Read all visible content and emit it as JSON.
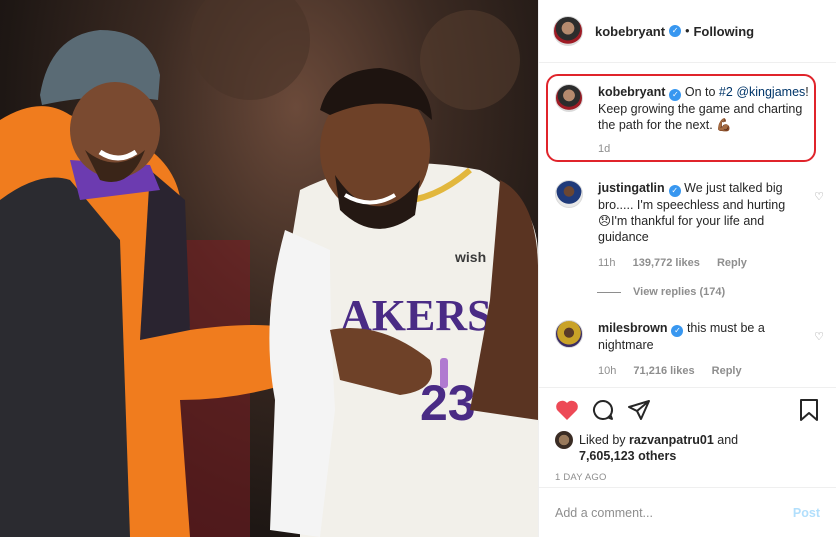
{
  "header": {
    "username": "kobebryant",
    "verified_icon": "verified-badge-icon",
    "separator": "•",
    "follow_status": "Following"
  },
  "caption": {
    "username": "kobebryant",
    "text_before": "On to ",
    "hashtag": "#2",
    "mention": "@kingjames",
    "text_after": "! Keep growing the game and charting the path for the next.",
    "emoji": "💪🏾",
    "time": "1d"
  },
  "comments": [
    {
      "username": "justingatlin",
      "text": "We just talked big bro..... I'm speechless and hurting",
      "emoji": "😞",
      "text2": "I'm thankful for your life and guidance",
      "time": "11h",
      "likes": "139,772 likes",
      "reply": "Reply",
      "view_replies": "View replies (174)"
    },
    {
      "username": "milesbrown",
      "text": "this must be a nightmare",
      "time": "10h",
      "likes": "71,216 likes",
      "reply": "Reply"
    }
  ],
  "likes": {
    "prefix": "Liked by ",
    "user": "razvanpatru01",
    "mid": " and",
    "count": "7,605,123 others"
  },
  "timestamp": "1 DAY AGO",
  "add_comment": {
    "placeholder": "Add a comment...",
    "post_label": "Post"
  },
  "colors": {
    "accent": "#3897f0",
    "like_red": "#ed4956",
    "highlight_box": "#e0242b",
    "post_disabled": "#b2dffc"
  }
}
